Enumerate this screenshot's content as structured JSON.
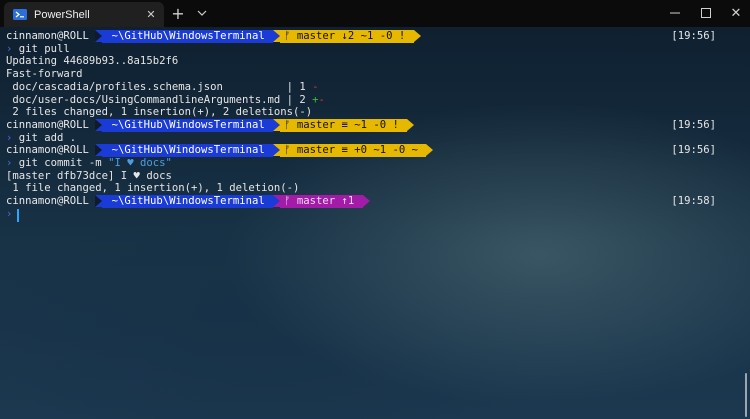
{
  "tab": {
    "title": "PowerShell",
    "close": "✕"
  },
  "titlebar": {
    "new_tab": "+",
    "dropdown": "⌄",
    "minimize": "—",
    "maximize": "☐",
    "close": "✕"
  },
  "colors": {
    "path_bg": "#1a3bd6",
    "git_clean": "#e6b800",
    "git_ahead": "#a21ca8",
    "chevron": "#4b6bd8",
    "string": "#4f9de0",
    "deletion": "#d23a3a",
    "insertion": "#3bbf3b"
  },
  "lines": [
    {
      "kind": "prompt",
      "user": "cinnamon@ROLL",
      "path": "~\\GitHub\\WindowsTerminal",
      "git": "ᚠ master ↓2 ~1 -0 !",
      "git_color": "#e6b800",
      "time": "[19:56]"
    },
    {
      "kind": "cmd",
      "chev": "›",
      "text": " git pull"
    },
    {
      "kind": "text",
      "text": "Updating 44689b93..8a15b2f6"
    },
    {
      "kind": "text",
      "text": "Fast-forward"
    },
    {
      "kind": "diff",
      "text": " doc/cascadia/profiles.schema.json          | 1 ",
      "mark": "-",
      "mark_class": "minus"
    },
    {
      "kind": "diff",
      "text": " doc/user-docs/UsingCommandlineArguments.md | 2 ",
      "mark": "+-",
      "mark_class": "plus"
    },
    {
      "kind": "text",
      "text": " 2 files changed, 1 insertion(+), 2 deletions(-)"
    },
    {
      "kind": "prompt",
      "user": "cinnamon@ROLL",
      "path": "~\\GitHub\\WindowsTerminal",
      "git": "ᚠ master ≡ ~1 -0 !",
      "git_color": "#e6b800",
      "time": "[19:56]"
    },
    {
      "kind": "cmd",
      "chev": "›",
      "text": " git add ."
    },
    {
      "kind": "prompt",
      "user": "cinnamon@ROLL",
      "path": "~\\GitHub\\WindowsTerminal",
      "git": "ᚠ master ≡ +0 ~1 -0 ~",
      "git_color": "#e6b800",
      "time": "[19:56]"
    },
    {
      "kind": "commit",
      "chev": "›",
      "text": " git commit -m ",
      "quote": "\"I ♥ docs\""
    },
    {
      "kind": "text",
      "text": "[master dfb73dce] I ♥ docs"
    },
    {
      "kind": "text",
      "text": " 1 file changed, 1 insertion(+), 1 deletion(-)"
    },
    {
      "kind": "prompt",
      "user": "cinnamon@ROLL",
      "path": "~\\GitHub\\WindowsTerminal",
      "git": "ᚠ master ↑1",
      "git_color": "#a21ca8",
      "time": "[19:58]"
    },
    {
      "kind": "cmd",
      "chev": "›",
      "text": ""
    }
  ]
}
